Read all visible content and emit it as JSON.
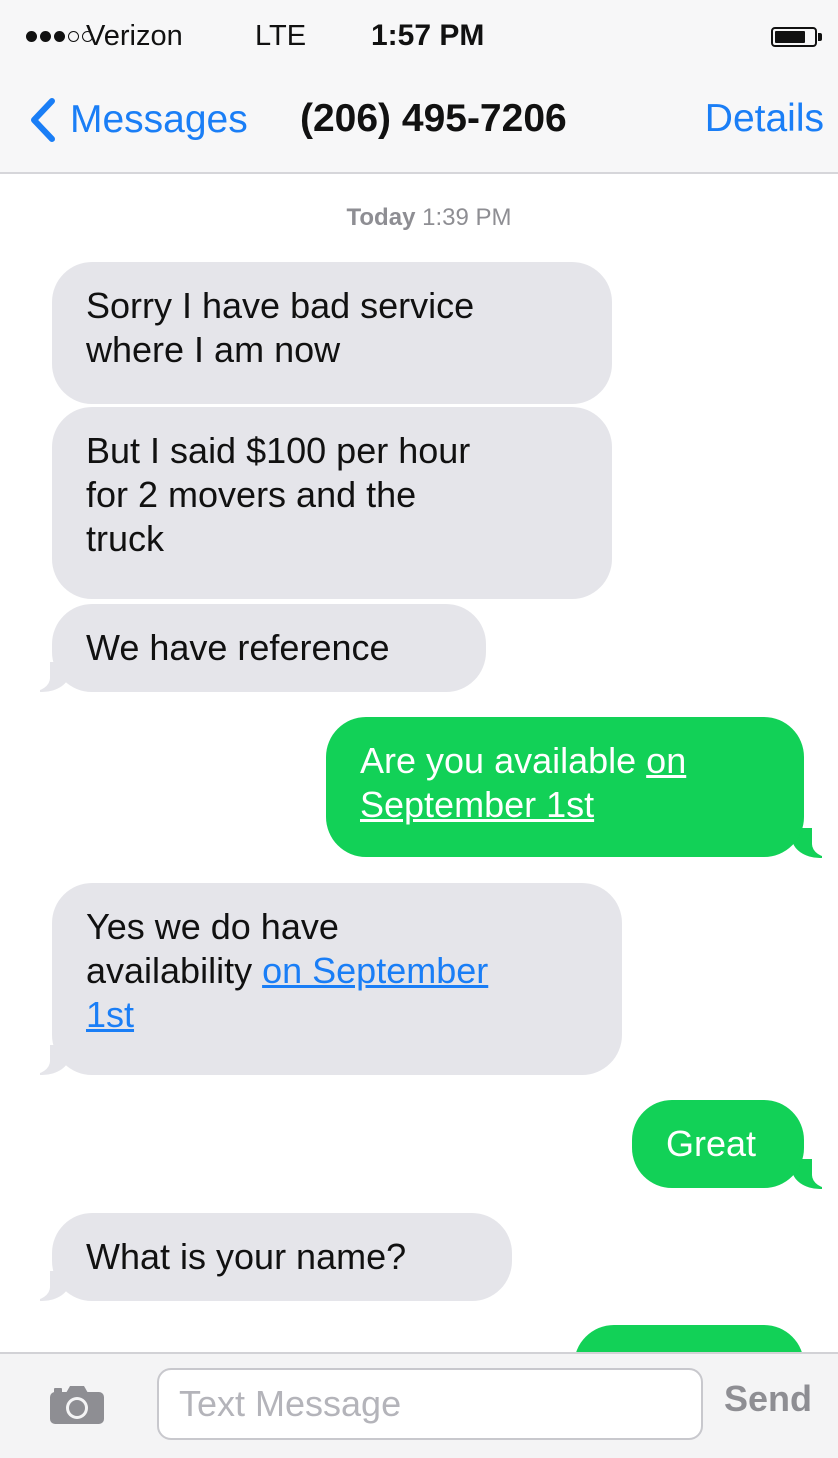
{
  "status_bar": {
    "carrier": "Verizon",
    "network": "LTE",
    "time": "1:57 PM",
    "signal_bars_filled": 3,
    "signal_bars_total": 5,
    "battery_level": 0.8
  },
  "nav": {
    "back_label": "Messages",
    "title": "(206) 495-7206",
    "details_label": "Details"
  },
  "timestamp": {
    "day": "Today",
    "time": "1:39 PM"
  },
  "messages": [
    {
      "direction": "incoming",
      "lines": [
        "Sorry I have bad service",
        "where I am now"
      ]
    },
    {
      "direction": "incoming",
      "lines": [
        "But I said $100 per hour",
        "for 2 movers and the",
        "truck"
      ]
    },
    {
      "direction": "incoming",
      "text": "We have reference"
    },
    {
      "direction": "outgoing",
      "prefix": "Are you available ",
      "link_part1": "on",
      "link_part2": "September 1st"
    },
    {
      "direction": "incoming",
      "line1": "Yes we do have",
      "line2_prefix": "availability ",
      "link_part1": "on September",
      "link_part2": "1st"
    },
    {
      "direction": "outgoing",
      "text": "Great"
    },
    {
      "direction": "incoming",
      "text": "What is your name?"
    }
  ],
  "input_bar": {
    "placeholder": "Text Message",
    "value": "",
    "send_label": "Send"
  },
  "colors": {
    "accent_blue": "#1a7ef6",
    "incoming_bubble": "#e5e5ea",
    "outgoing_bubble": "#12d157"
  },
  "icons": {
    "back": "chevron-left-icon",
    "camera": "camera-icon",
    "battery": "battery-icon",
    "signal": "signal-dots-icon"
  }
}
